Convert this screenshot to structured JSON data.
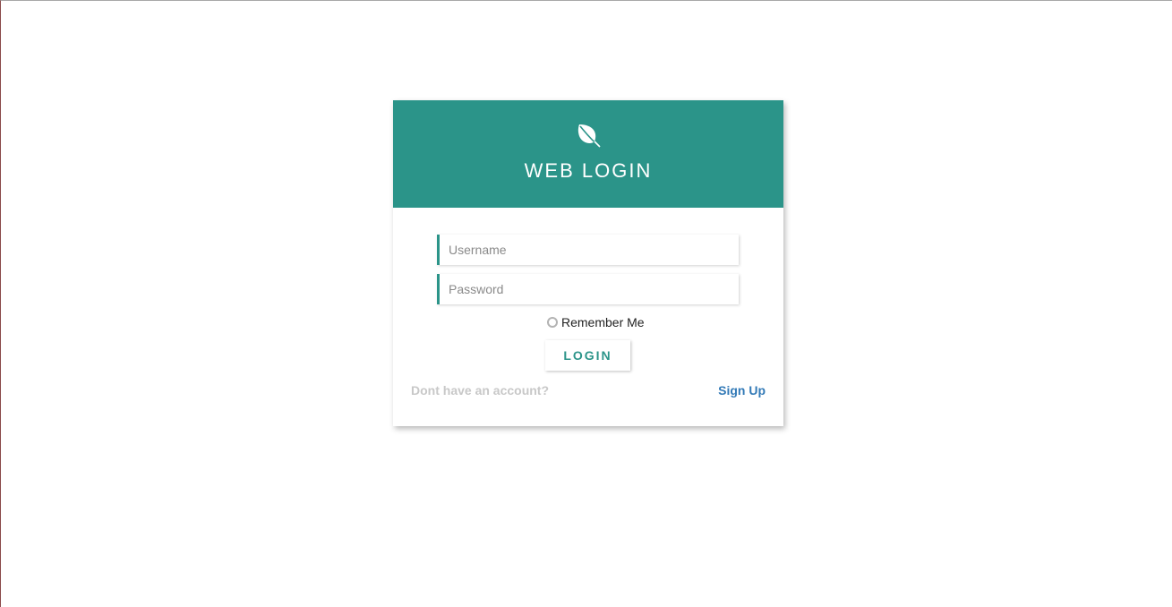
{
  "header": {
    "icon": "leaf-icon",
    "title": "WEB LOGIN",
    "color": "#2b9489"
  },
  "form": {
    "username_placeholder": "Username",
    "username_value": "",
    "password_placeholder": "Password",
    "password_value": "",
    "remember_label": "Remember Me",
    "remember_checked": false,
    "login_label": "LOGIN"
  },
  "footer": {
    "prompt": "Dont have an account?",
    "signup_label": "Sign Up",
    "link_color": "#337ab7"
  }
}
